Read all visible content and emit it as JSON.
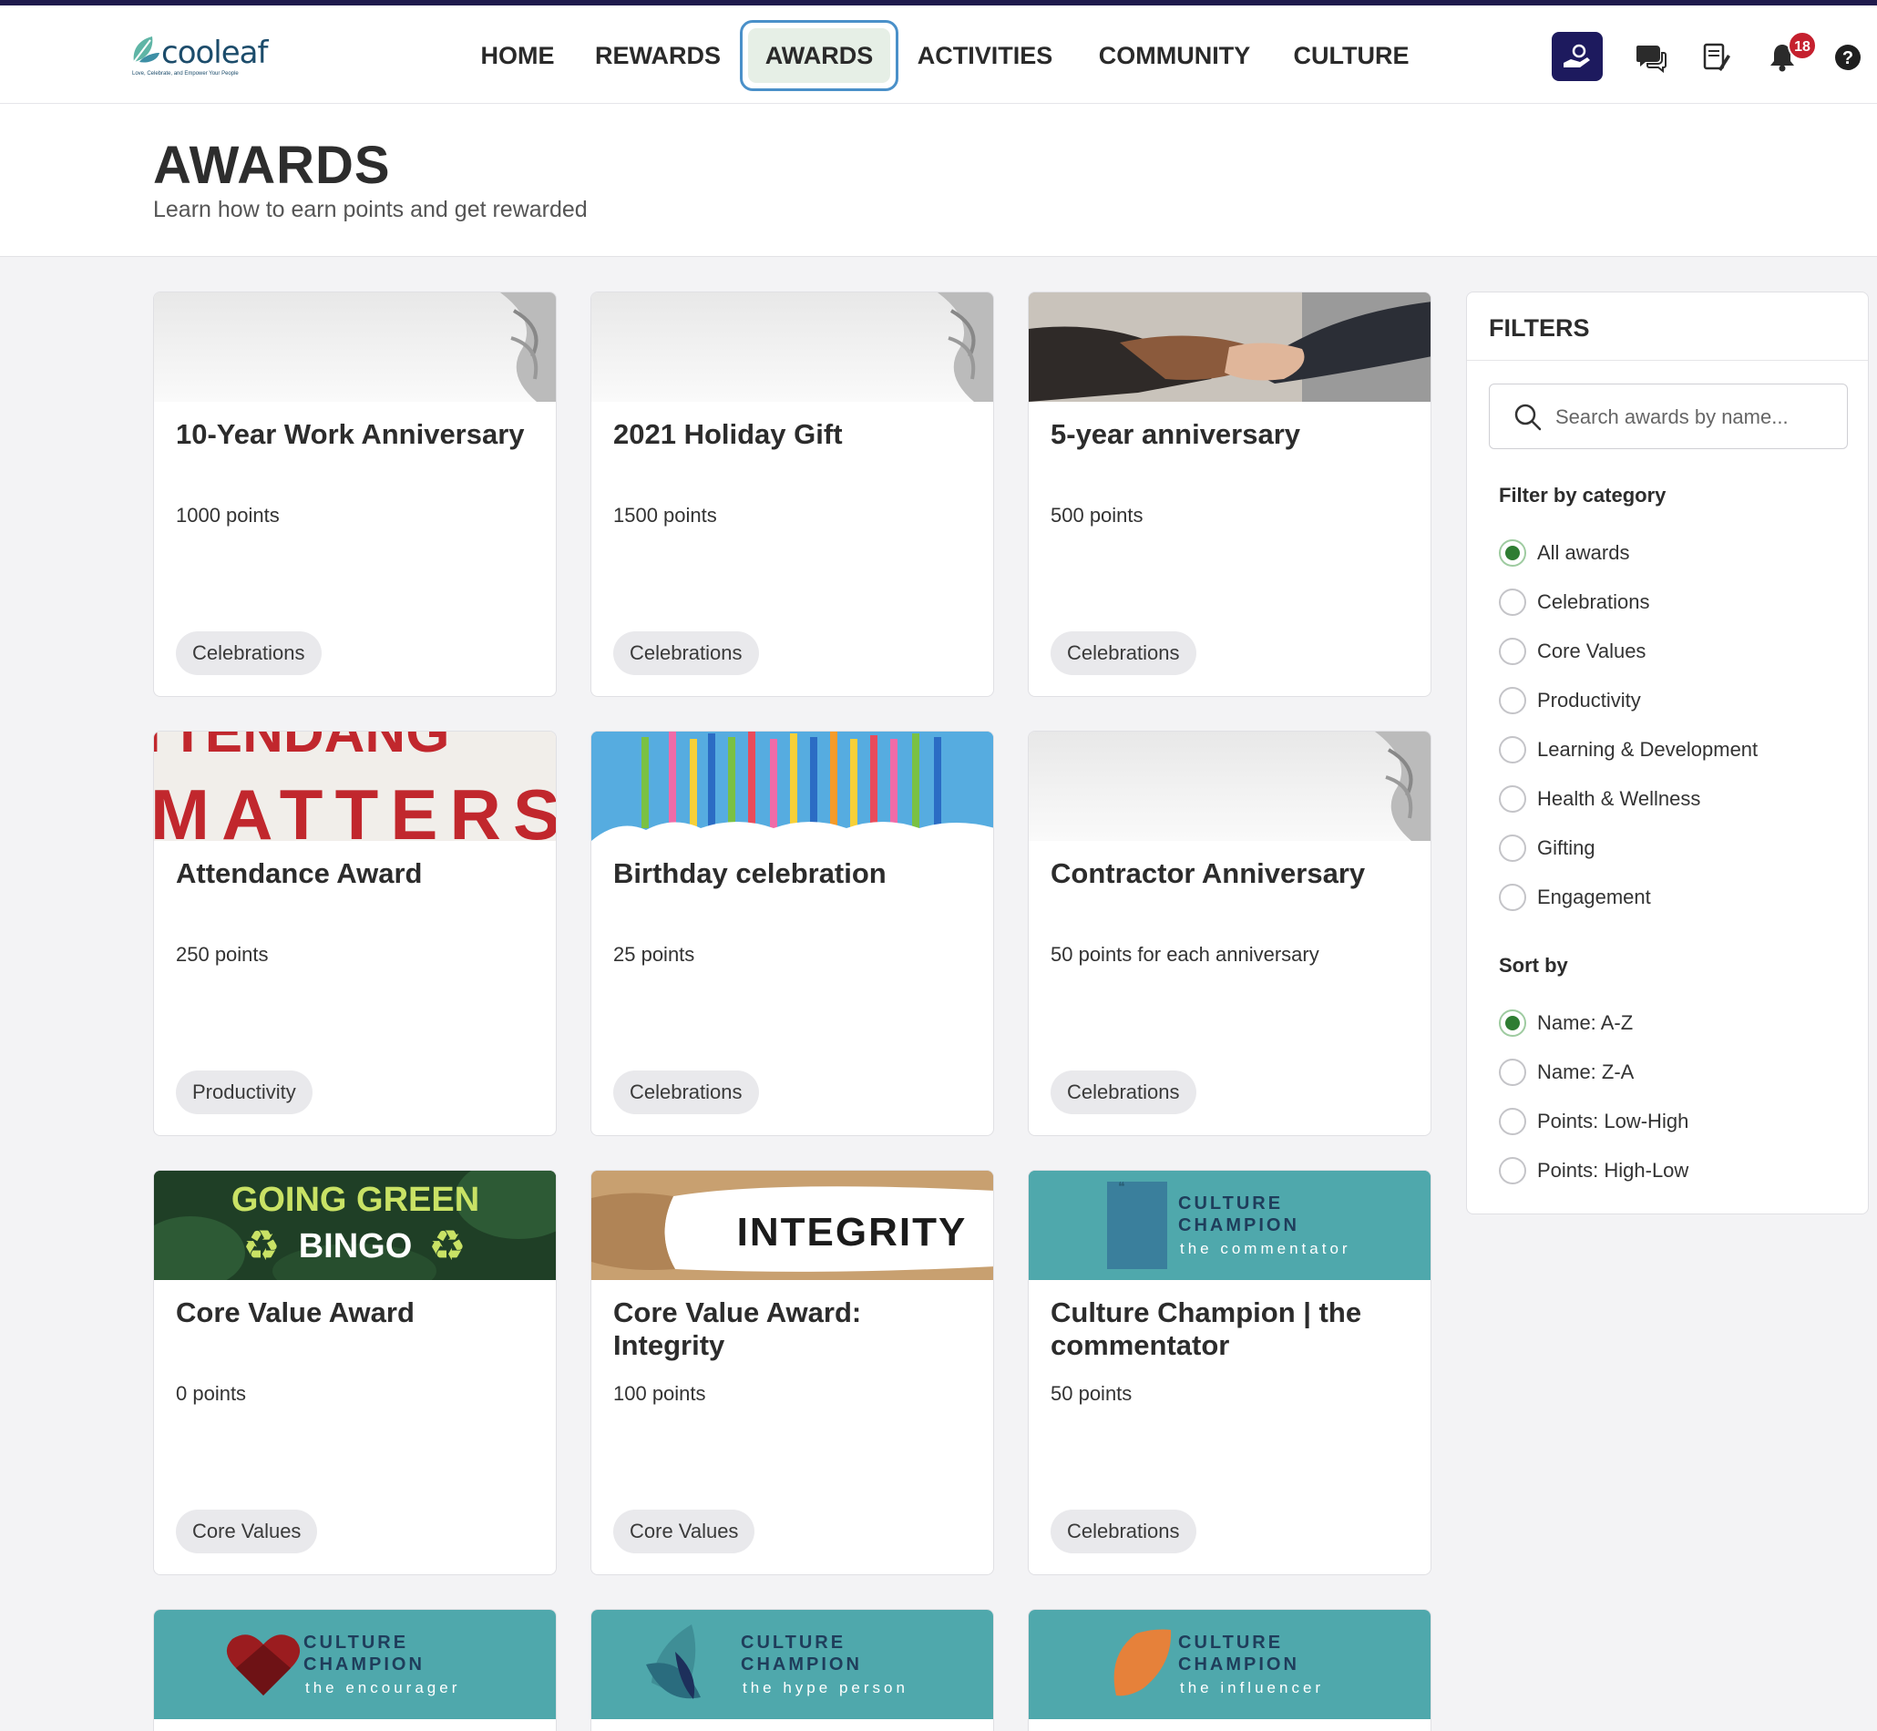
{
  "brand": {
    "name": "cooleaf",
    "tagline": "Love, Celebrate, and Empower Your People"
  },
  "nav": {
    "items": [
      {
        "label": "HOME",
        "active": false
      },
      {
        "label": "REWARDS",
        "active": false
      },
      {
        "label": "AWARDS",
        "active": true
      },
      {
        "label": "ACTIVITIES",
        "active": false
      },
      {
        "label": "COMMUNITY",
        "active": false
      },
      {
        "label": "CULTURE",
        "active": false
      }
    ],
    "icons": [
      "give-recognition-icon",
      "chat-icon",
      "document-icon",
      "bell-icon",
      "help-icon"
    ],
    "notification_count": "18"
  },
  "header": {
    "title": "AWARDS",
    "subtitle": "Learn how to earn points and get rewarded"
  },
  "awards": [
    {
      "title": "10-Year Work Anniversary",
      "points": "1000 points",
      "category": "Celebrations",
      "image": "hand-gray"
    },
    {
      "title": "2021 Holiday Gift",
      "points": "1500 points",
      "category": "Celebrations",
      "image": "hand-gray"
    },
    {
      "title": "5-year anniversary",
      "points": "500 points",
      "category": "Celebrations",
      "image": "handshake"
    },
    {
      "title": "Attendance Award",
      "points": "250 points",
      "category": "Productivity",
      "image": "attendance-matters"
    },
    {
      "title": "Birthday celebration",
      "points": "25 points",
      "category": "Celebrations",
      "image": "birthday-candles"
    },
    {
      "title": "Contractor Anniversary",
      "points": "50 points for each anniversary",
      "category": "Celebrations",
      "image": "hand-gray"
    },
    {
      "title": "Core Value Award",
      "points": "0 points",
      "category": "Core Values",
      "image": "going-green-bingo"
    },
    {
      "title": "Core Value Award: Integrity",
      "points": "100 points",
      "category": "Core Values",
      "image": "integrity"
    },
    {
      "title": "Culture Champion | the commentator",
      "points": "50 points",
      "category": "Celebrations",
      "image": "culture-champion"
    }
  ],
  "images": {
    "attendance": {
      "line1": "TTENDANG",
      "line2": "MATTERS"
    },
    "bingo": {
      "line1": "GOING GREEN",
      "line2": "BINGO"
    },
    "integrity": "INTEGRITY",
    "champion": {
      "line1": "CULTURE",
      "line2": "CHAMPION"
    }
  },
  "partial_cards": [
    {
      "subtitle": "the encourager",
      "emblem": "heart"
    },
    {
      "subtitle": "the hype person",
      "emblem": "leaves"
    },
    {
      "subtitle": "the influencer",
      "emblem": "leaf"
    }
  ],
  "commentator_subtitle": "the commentator",
  "filters": {
    "title": "FILTERS",
    "search_placeholder": "Search awards by name...",
    "category_label": "Filter by category",
    "categories": [
      {
        "label": "All awards",
        "checked": true
      },
      {
        "label": "Celebrations",
        "checked": false
      },
      {
        "label": "Core Values",
        "checked": false
      },
      {
        "label": "Productivity",
        "checked": false
      },
      {
        "label": "Learning & Development",
        "checked": false
      },
      {
        "label": "Health & Wellness",
        "checked": false
      },
      {
        "label": "Gifting",
        "checked": false
      },
      {
        "label": "Engagement",
        "checked": false
      }
    ],
    "sort_label": "Sort by",
    "sort_options": [
      {
        "label": "Name: A-Z",
        "checked": true
      },
      {
        "label": "Name: Z-A",
        "checked": false
      },
      {
        "label": "Points: Low-High",
        "checked": false
      },
      {
        "label": "Points: High-Low",
        "checked": false
      }
    ]
  },
  "colors": {
    "nav_dark": "#1f1b4d",
    "accent_green": "#2e7d32",
    "badge_red": "#c5202e",
    "teal": "#4fa8ac"
  }
}
